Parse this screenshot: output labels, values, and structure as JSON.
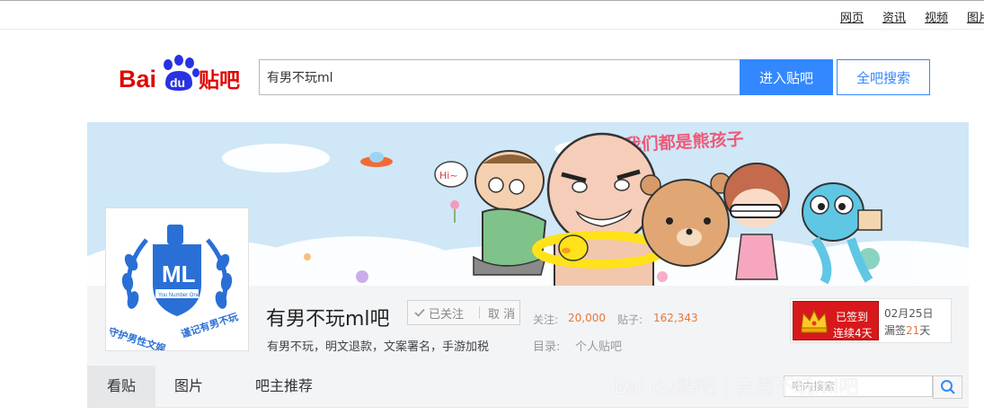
{
  "topnav": [
    "网页",
    "资讯",
    "视频",
    "图片"
  ],
  "logo": {
    "text_bai": "Bai",
    "text_du": "du",
    "text_tieba": "贴吧"
  },
  "search": {
    "value": "有男不玩ml",
    "enter_label": "进入贴吧",
    "search_all_label": "全吧搜索"
  },
  "banner": {
    "slogan": "我们都是熊孩子",
    "hi_bubble": "Hi~"
  },
  "forum": {
    "name": "有男不玩ml吧",
    "follow_label": "已关注",
    "unfollow_label": "取 消",
    "followers_label": "关注:",
    "followers_value": "20,000",
    "posts_label": "贴子:",
    "posts_value": "162,343",
    "slogan": "有男不玩，明文退款，文案署名，手游加税",
    "catalog_label": "目录:",
    "catalog_value": "个人贴吧",
    "avatar_text": {
      "center": "ML",
      "ribbon": "You Number One",
      "left": "守护男性文娱",
      "right": "谨记有男不玩"
    }
  },
  "sign": {
    "line1": "已签到",
    "line2": "连续4天",
    "date": "02月25日",
    "missed_prefix": "漏签",
    "missed_days": "21",
    "missed_suffix": "天"
  },
  "tabs": [
    "看贴",
    "图片",
    "吧主推荐"
  ],
  "inner_search": {
    "placeholder": "吧内搜索"
  },
  "watermark": "Bai du贴吧 | 有男不玩ml吧",
  "colors": {
    "accent_blue": "#3388ff",
    "baidu_red": "#e10601",
    "baidu_blue": "#2932e1",
    "stat_orange": "#e8753a",
    "sign_red": "#d8181a",
    "banner_sky": "#cfe7f7"
  },
  "icons": [
    "check-icon",
    "crown-icon",
    "search-icon",
    "ufo-icon",
    "paw-icon"
  ]
}
